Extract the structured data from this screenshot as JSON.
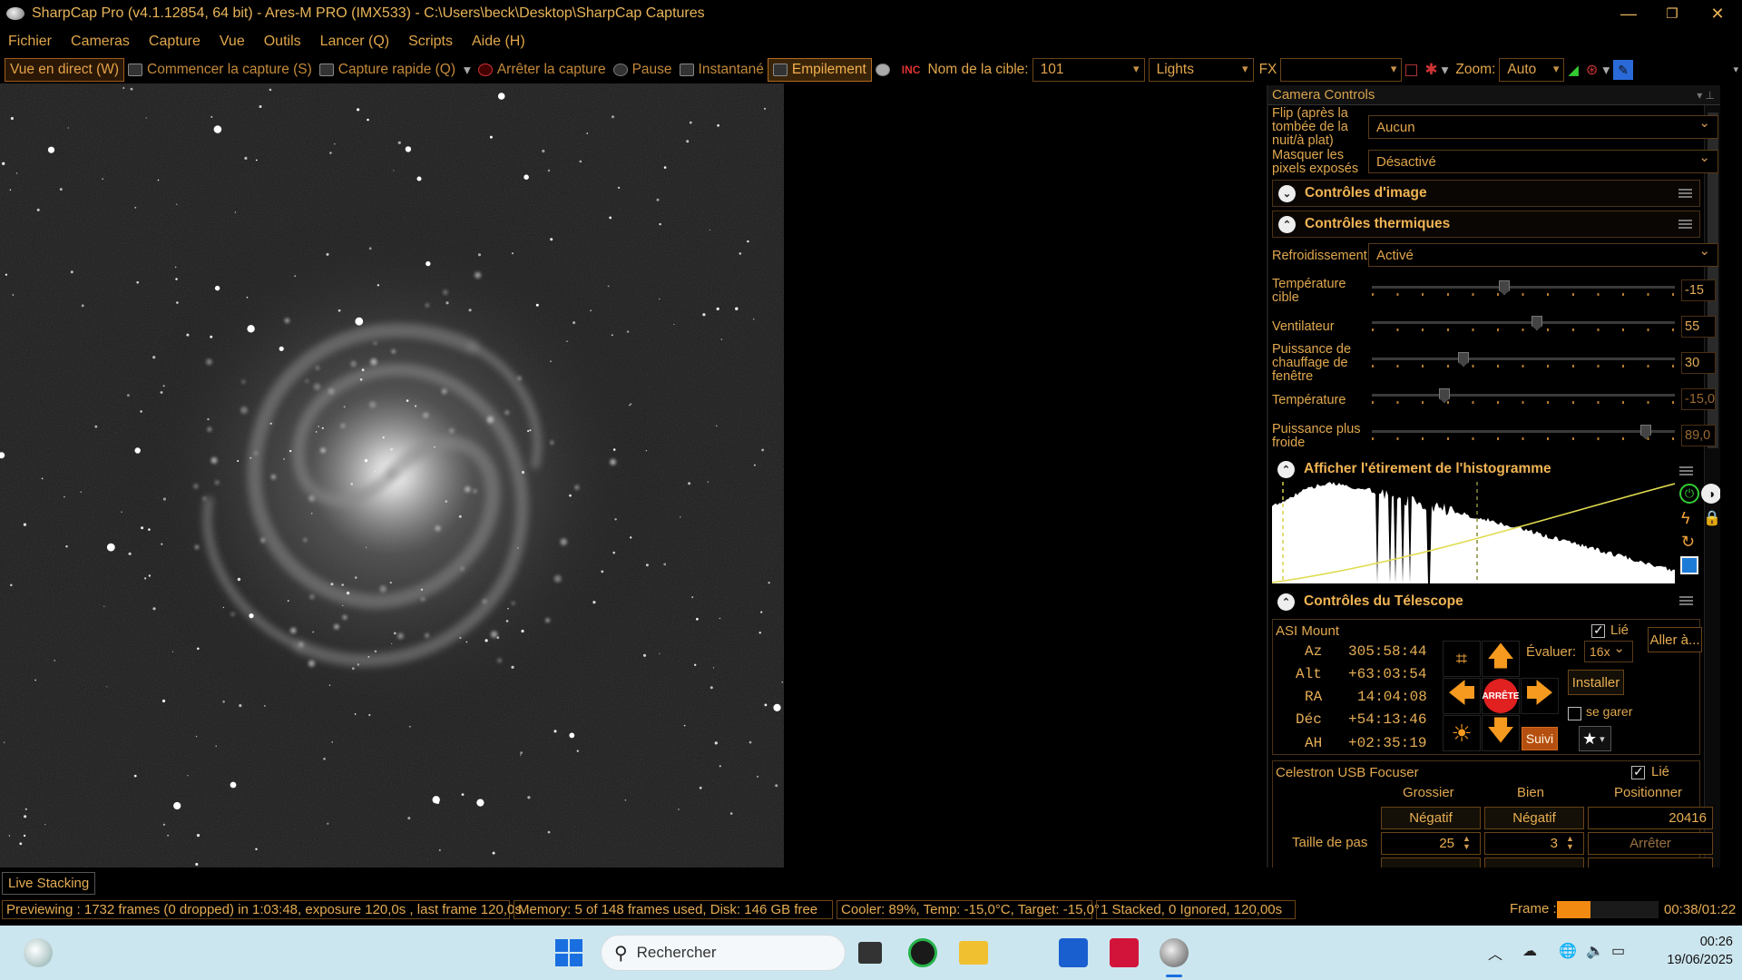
{
  "window": {
    "title": "SharpCap Pro (v4.1.12854, 64 bit) - Ares-M PRO (IMX533) - C:\\Users\\beck\\Desktop\\SharpCap Captures"
  },
  "menu": [
    "Fichier",
    "Cameras",
    "Capture",
    "Vue",
    "Outils",
    "Lancer (Q)",
    "Scripts",
    "Aide (H)"
  ],
  "toolbar": {
    "live": "Vue en direct (W)",
    "start": "Commencer la capture (S)",
    "quick": "Capture rapide (Q)",
    "stop": "Arrêter la capture",
    "pause": "Pause",
    "snapshot": "Instantané",
    "stacking": "Empilement",
    "target_label": "Nom de la cible:",
    "target_value": "101",
    "frame_type": "Lights",
    "fx_label": "FX",
    "fx_value": "",
    "zoom_label": "Zoom:",
    "zoom_value": "Auto"
  },
  "panel": {
    "title": "Camera Controls",
    "flip_label": "Flip (après la tombée de la nuit/à plat)",
    "flip_value": "Aucun",
    "mask_label": "Masquer les pixels exposés",
    "mask_value": "Désactivé",
    "image_controls": "Contrôles d'image",
    "thermal": {
      "title": "Contrôles thermiques",
      "cooling_label": "Refroidissement",
      "cooling_value": "Activé",
      "target_temp_label": "Température cible",
      "target_temp_value": "-15",
      "fan_label": "Ventilateur",
      "fan_value": "55",
      "heater_label": "Puissance de chauffage de fenêtre",
      "heater_value": "30",
      "temp_label": "Température",
      "temp_value": "-15,0",
      "cooler_power_label": "Puissance plus froide",
      "cooler_power_value": "89,0"
    },
    "histogram": {
      "title": "Afficher l'étirement de l'histogramme"
    },
    "telescope": {
      "title": "Contrôles du Télescope",
      "mount": "ASI Mount",
      "linked": "Lié",
      "goto": "Aller à...",
      "az_label": "Az",
      "az": "305:58:44",
      "alt_label": "Alt",
      "alt": "+63:03:54",
      "ra_label": "RA",
      "ra": "14:04:08",
      "dec_label": "Déc",
      "dec": "+54:13:46",
      "ah_label": "AH",
      "ah": "+02:35:19",
      "rate_label": "Évaluer:",
      "rate_value": "16x",
      "setup": "Installer",
      "park": "se garer",
      "stop": "ARRÊTE",
      "tracking": "Suivi"
    },
    "focuser": {
      "title": "Celestron USB Focuser",
      "linked": "Lié",
      "coarse": "Grossier",
      "fine": "Bien",
      "position": "Positionner",
      "neg1": "Négatif",
      "neg2": "Négatif",
      "position_value": "20416",
      "step_label": "Taille de pas",
      "step_coarse": "25",
      "step_fine": "3",
      "stop": "Arrêter"
    }
  },
  "live_stacking_label": "Live Stacking",
  "status": {
    "preview": "Previewing : 1732 frames (0 dropped) in 1:03:48, exposure 120,0s , last frame 120,0s",
    "memory": "Memory: 5 of 148 frames used, Disk: 146 GB free",
    "cooler": "Cooler: 89%, Temp: -15,0°C, Target: -15,0°",
    "stacked": "1 Stacked, 0 Ignored, 120,00s",
    "frame_label": "Frame :",
    "frame_progress": 0.33,
    "time": "00:38/01:22"
  },
  "taskbar": {
    "search_placeholder": "Rechercher",
    "time": "00:26",
    "date": "19/06/2025"
  },
  "colors": {
    "accent": "#e3a64c",
    "border": "#6a4419",
    "taskbar": "#cce6ef"
  }
}
